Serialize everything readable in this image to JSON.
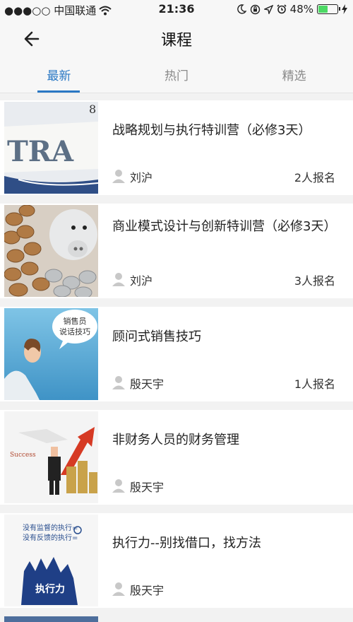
{
  "status": {
    "carrier": "●●●○○ 中国联通",
    "time": "21:36",
    "battery": "48%",
    "battery_level": 0.48,
    "icons": [
      "wifi-icon",
      "moon-icon",
      "lock-rotation-icon",
      "location-icon",
      "alarm-icon",
      "charging-icon"
    ]
  },
  "nav": {
    "title": "课程"
  },
  "tabs": [
    {
      "label": "最新",
      "active": true
    },
    {
      "label": "热门",
      "active": false
    },
    {
      "label": "精选",
      "active": false
    }
  ],
  "courses": [
    {
      "title": "战略规划与执行特训营（必修3天）",
      "author": "刘沪",
      "count": "2人报名",
      "thumb_text": "TRA"
    },
    {
      "title": "商业模式设计与创新特训营（必修3天）",
      "author": "刘沪",
      "count": "3人报名"
    },
    {
      "title": "顾问式销售技巧",
      "author": "殷天宇",
      "count": "1人报名",
      "thumb_text": "销售员说话技巧"
    },
    {
      "title": "非财务人员的财务管理",
      "author": "殷天宇",
      "count": "",
      "thumb_text": "Success"
    },
    {
      "title": "执行力--别找借口，找方法",
      "author": "殷天宇",
      "count": "",
      "thumb_text": "执行力"
    }
  ],
  "colors": {
    "accent": "#2a78c4",
    "battery": "#4cd964"
  }
}
